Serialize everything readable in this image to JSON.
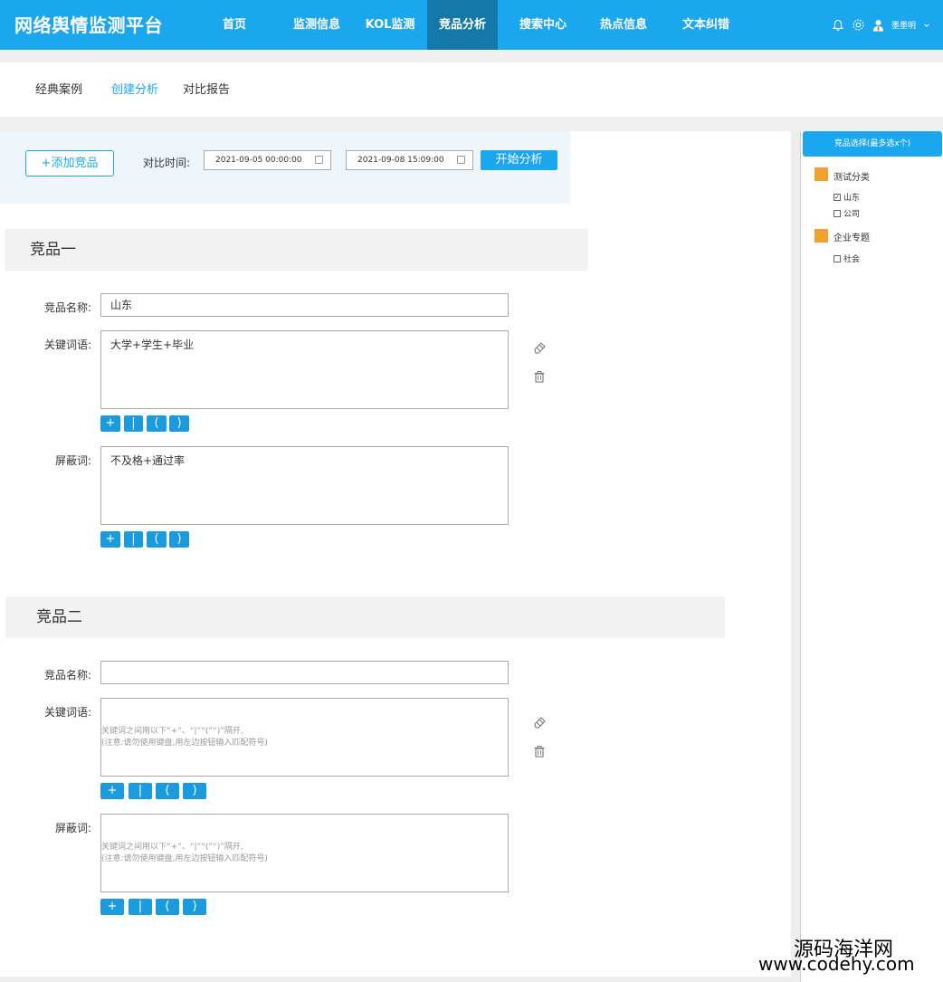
{
  "header": {
    "logo": "网络舆情监测平台",
    "nav": [
      {
        "label": "首页",
        "active": false
      },
      {
        "label": "监测信息",
        "active": false
      },
      {
        "label": "KOL监测",
        "active": false
      },
      {
        "label": "竞品分析",
        "active": true
      },
      {
        "label": "搜索中心",
        "active": false
      },
      {
        "label": "热点信息",
        "active": false
      },
      {
        "label": "文本纠错",
        "active": false
      }
    ],
    "user_name": "墨墨明",
    "icons": [
      "bell-icon",
      "gear-icon",
      "user-avatar-icon",
      "chevron-down-icon"
    ],
    "colors": {
      "primary": "#1aa7ee",
      "active_nav": "#1479a8",
      "category": "#f2a032"
    }
  },
  "subnav": {
    "tabs": [
      {
        "label": "经典案例",
        "active": false
      },
      {
        "label": "创建分析",
        "active": true
      },
      {
        "label": "对比报告",
        "active": false
      }
    ]
  },
  "toolbar": {
    "add_label": "+添加竞品",
    "time_label": "对比时间:",
    "start_date": "2021-09-05  00:00:00",
    "end_date": "2021-09-08  15:09:00",
    "start_label": "开始分析"
  },
  "competitors": [
    {
      "title": "竞品一",
      "name_label": "竞品名称:",
      "name_value": "山东",
      "keywords_label": "关键词语:",
      "keywords_value": "大学+学生+毕业",
      "block_label": "屏蔽词:",
      "block_value": "不及格+通过率",
      "ops": [
        "+",
        "|",
        "(",
        ")"
      ]
    },
    {
      "title": "竞品二",
      "name_label": "竞品名称:",
      "name_value": "",
      "keywords_label": "关键词语:",
      "keywords_placeholder_1": "关键词之间用以下“+”、“|”“(”“)”隔开,",
      "keywords_placeholder_2": "(注意:请勿使用键盘,用左边按钮输入匹配符号)",
      "block_label": "屏蔽词:",
      "block_placeholder_1": "关键词之间用以下“+”、“|”“(”“)”隔开,",
      "block_placeholder_2": "(注意:请勿使用键盘,用左边按钮输入匹配符号)",
      "ops": [
        "+",
        "|",
        "(",
        ")"
      ]
    }
  ],
  "right_panel": {
    "header": "竞品选择(最多选x个)",
    "categories": [
      {
        "label": "测试分类",
        "items": [
          {
            "label": "山东",
            "checked": true
          },
          {
            "label": "公司",
            "checked": false
          }
        ]
      },
      {
        "label": "企业专题",
        "items": [
          {
            "label": "社会",
            "checked": false
          }
        ]
      }
    ]
  },
  "watermark": {
    "line1": "源码海洋网",
    "line2": "www.codehy.com"
  }
}
